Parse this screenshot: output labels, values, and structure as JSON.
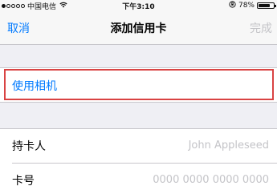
{
  "status_bar": {
    "signal_dots_filled": 1,
    "signal_dots_total": 5,
    "carrier": "中国电信",
    "time": "下午3:10",
    "battery_percent_label": "78%",
    "battery_level": 0.78,
    "icons": [
      "wifi-icon",
      "orientation-lock-icon",
      "battery-icon"
    ]
  },
  "nav": {
    "cancel_label": "取消",
    "title": "添加信用卡",
    "done_label": "完成"
  },
  "camera": {
    "label": "使用相机"
  },
  "card_form": {
    "holder_label": "持卡人",
    "holder_placeholder": "John Appleseed",
    "number_label": "卡号",
    "number_placeholder": "0000 0000 0000 0000"
  },
  "colors": {
    "accent": "#007aff",
    "disabled": "#c4c4c8",
    "highlight": "#d94343",
    "background": "#efeff4"
  }
}
